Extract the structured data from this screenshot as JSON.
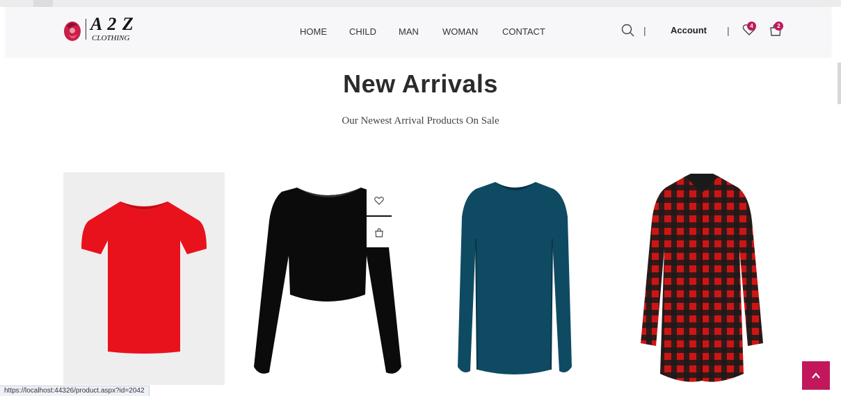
{
  "brand": {
    "name": "A 2 Z",
    "sub": "CLOTHING"
  },
  "nav": {
    "items": [
      "HOME",
      "CHILD",
      "MAN",
      "WOMAN",
      "CONTACT"
    ]
  },
  "header": {
    "separator": "|",
    "account": "Account",
    "wishlist_count": "4",
    "cart_count": "2"
  },
  "section": {
    "title": "New Arrivals",
    "subtitle": "Our Newest Arrival Products On Sale"
  },
  "products": [
    {
      "icon": "red-tshirt-image",
      "color": "#e8121d"
    },
    {
      "icon": "black-crop-top-image",
      "color": "#0b0b0b"
    },
    {
      "icon": "teal-longsleeve-image",
      "color": "#0f4a63"
    },
    {
      "icon": "red-plaid-shirt-image",
      "color": "#cc1515"
    }
  ],
  "hover_actions": {
    "wishlist_icon": "heart-icon",
    "cart_icon": "bag-icon"
  },
  "status_bar": {
    "url": "https://localhost:44326/product.aspx?id=2042"
  },
  "colors": {
    "accent": "#c2185b",
    "header_bg": "#f7f7f9"
  }
}
